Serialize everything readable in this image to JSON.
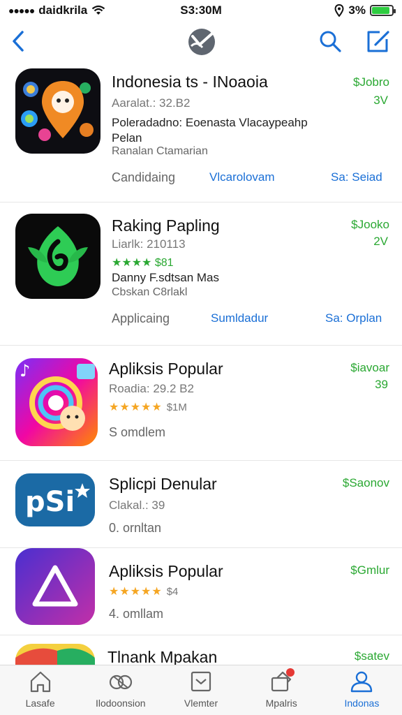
{
  "status_bar": {
    "carrier": "daidkrila",
    "time": "S3:30M",
    "battery_text": "3%",
    "battery_level": 0.9
  },
  "nav": {
    "back_icon": "chevron-left-icon",
    "logo_icon": "app-logo-icon",
    "search_icon": "search-icon",
    "compose_icon": "compose-icon"
  },
  "apps": [
    {
      "title": "Indonesia ts - INoaoia",
      "meta": "Aaralat.: 32.B2",
      "description": "Poleradadno: Eoenasta Vlacaypeahp",
      "description2": "Pelan",
      "subtitle": "Ranalan Ctamarian",
      "category": "Candidaing",
      "link1": "Vlcarolovam",
      "link2": "Sa: Seiad",
      "price": "$Jobro",
      "size": "3V"
    },
    {
      "title": "Raking Papling",
      "meta": "Liarlk: 210113",
      "rating": "★★★★ $81",
      "description": "Danny F.sdtsan Mas",
      "subtitle": "Cbskan C8rlakl",
      "category": "Applicaing",
      "link1": "Sumldadur",
      "link2": "Sa: Orplan",
      "price": "$Jooko",
      "size": "2V"
    },
    {
      "title": "Apliksis Popular",
      "meta": "Roadia: 29.2 B2",
      "rating_stars": "★★★★★",
      "rating_count": "$1M",
      "subtitle": "S omdlem",
      "price": "$iavoar",
      "size": "39"
    },
    {
      "title": "Splicpi Denular",
      "meta": "Clakal.: 39",
      "subtitle": "0. ornltan",
      "price": "$Saonov"
    },
    {
      "title": "Apliksis Popular",
      "rating_stars": "★★★★★",
      "rating_count": "$4",
      "subtitle": "4. omllam",
      "price": "$Gmlur"
    },
    {
      "title": "Tlnank Mpakan",
      "price": "$satev"
    }
  ],
  "tabs": [
    {
      "label": "Lasafe",
      "icon": "home-icon",
      "active": false
    },
    {
      "label": "Ilodoonsion",
      "icon": "games-icon",
      "active": false
    },
    {
      "label": "Vlemter",
      "icon": "inbox-icon",
      "active": false
    },
    {
      "label": "Mpalris",
      "icon": "updates-icon",
      "active": false
    },
    {
      "label": "Indonas",
      "icon": "profile-icon",
      "active": true
    }
  ],
  "colors": {
    "accent_blue": "#1a6fd6",
    "price_green": "#2aa832",
    "star_gold": "#f5a623"
  }
}
